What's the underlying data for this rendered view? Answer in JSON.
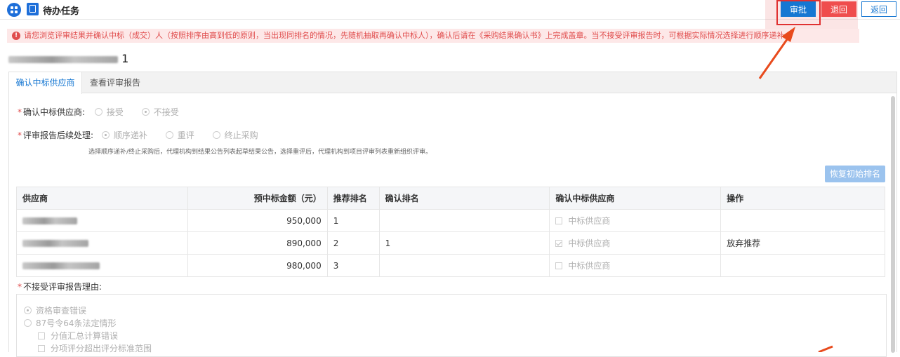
{
  "header": {
    "title": "待办任务",
    "approve_label": "审批",
    "reject_label": "退回",
    "back_label": "返回"
  },
  "notice": {
    "text": "请您浏览评审结果并确认中标（成交）人（按照排序由高到低的原则，当出现同排名的情况，先随机抽取再确认中标人），确认后请在《采购结果确认书》上完成盖章。当不接受评审报告时，可根据实际情况选择进行顺序递补"
  },
  "project": {
    "suffix": "1"
  },
  "tabs": [
    {
      "label": "确认中标供应商"
    },
    {
      "label": "查看评审报告"
    }
  ],
  "form": {
    "confirm_label": "确认中标供应商:",
    "confirm_options": [
      "接受",
      "不接受"
    ],
    "followup_label": "评审报告后续处理:",
    "followup_options": [
      "顺序递补",
      "重评",
      "终止采购"
    ],
    "hint": "选择顺序递补/终止采购后，代理机构到结果公告列表起草结果公告，选择重评后，代理机构到项目评审列表重新组织评审。",
    "restore_label": "恢复初始排名"
  },
  "table": {
    "headers": [
      "供应商",
      "预中标金额（元）",
      "推荐排名",
      "确认排名",
      "确认中标供应商",
      "操作"
    ],
    "rows": [
      {
        "amount": "950,000",
        "rec_rank": "1",
        "confirm_rank": "",
        "winner_label": "中标供应商",
        "checked": false,
        "action": ""
      },
      {
        "amount": "890,000",
        "rec_rank": "2",
        "confirm_rank": "1",
        "winner_label": "中标供应商",
        "checked": true,
        "action": "放弃推荐"
      },
      {
        "amount": "980,000",
        "rec_rank": "3",
        "confirm_rank": "",
        "winner_label": "中标供应商",
        "checked": false,
        "action": ""
      }
    ]
  },
  "reason": {
    "label": "不接受评审报告理由:",
    "opt1": "资格审查错误",
    "opt2": "87号令64条法定情形",
    "sub1": "分值汇总计算错误",
    "sub2": "分项评分超出评分标准范围"
  },
  "colors": {
    "primary": "#1677d2",
    "danger": "#ef4d4d",
    "annotation": "#e03131"
  }
}
